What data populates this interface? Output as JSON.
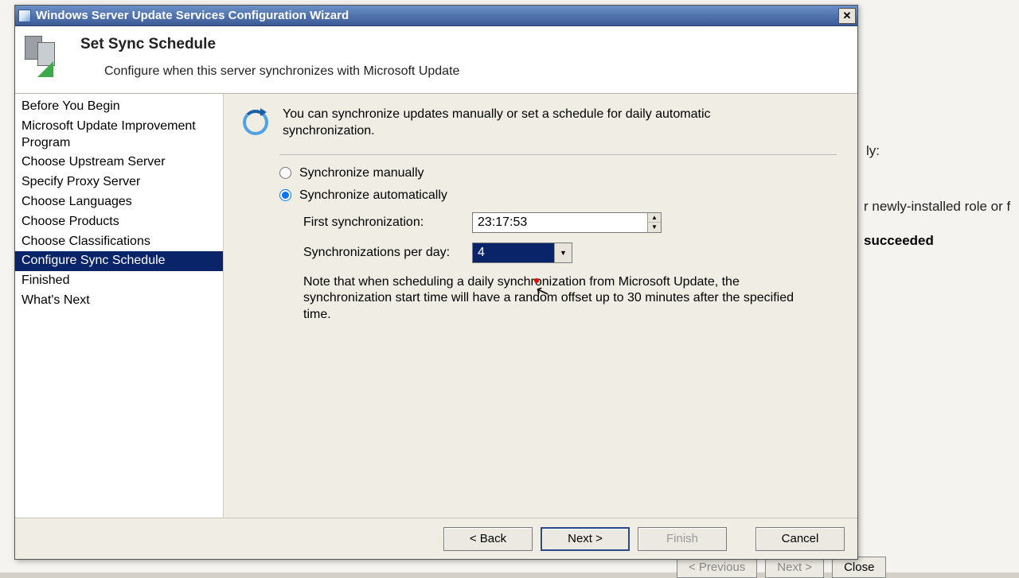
{
  "titlebar": {
    "title": "Windows Server Update Services Configuration Wizard"
  },
  "header": {
    "title": "Set Sync Schedule",
    "subtitle": "Configure when this server synchronizes with Microsoft Update"
  },
  "sidebar": {
    "items": [
      {
        "label": "Before You Begin"
      },
      {
        "label": "Microsoft Update Improvement Program"
      },
      {
        "label": "Choose Upstream Server"
      },
      {
        "label": "Specify Proxy Server"
      },
      {
        "label": "Choose Languages"
      },
      {
        "label": "Choose Products"
      },
      {
        "label": "Choose Classifications"
      },
      {
        "label": "Configure Sync Schedule",
        "selected": true
      },
      {
        "label": "Finished"
      },
      {
        "label": "What's Next"
      }
    ]
  },
  "content": {
    "intro": "You can synchronize updates manually or set a schedule for daily automatic synchronization.",
    "option_manual": "Synchronize manually",
    "option_auto": "Synchronize automatically",
    "first_sync_label": "First synchronization:",
    "first_sync_value": "23:17:53",
    "syncs_per_day_label": "Synchronizations per day:",
    "syncs_per_day_value": "4",
    "note": "Note that when scheduling a daily synchronization from Microsoft Update, the synchronization start time will have a random offset up to 30 minutes after the specified time."
  },
  "footer": {
    "back": "< Back",
    "next": "Next >",
    "finish": "Finish",
    "cancel": "Cancel"
  },
  "background": {
    "line1": "ly:",
    "line2": "r newly-installed role or f",
    "bold": "succeeded",
    "prev": "< Previous",
    "nextbg": "Next >",
    "close": "Close"
  }
}
